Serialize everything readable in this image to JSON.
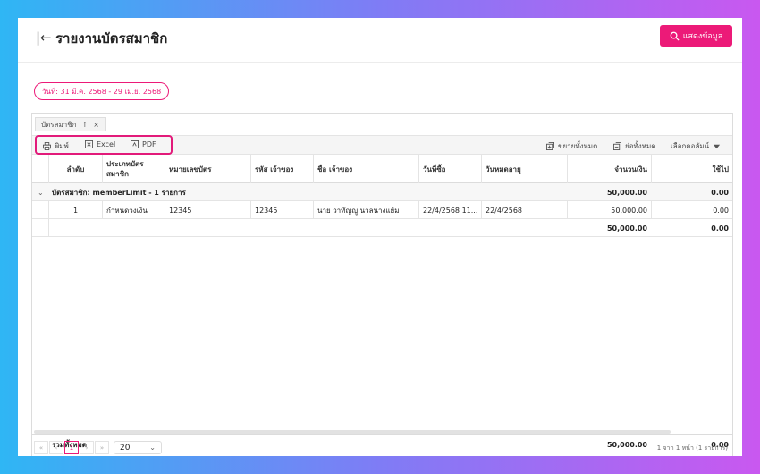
{
  "header": {
    "title": "รายงานบัตรสมาชิก",
    "show_button": "แสดงข้อมูล"
  },
  "filter": {
    "date_range": "วันที่: 31 มี.ค. 2568 - 29 เม.ย. 2568"
  },
  "grid": {
    "group_tab": {
      "label": "บัตรสมาชิก",
      "sort": "↑",
      "remove": "×"
    },
    "toolbar": {
      "print": "พิมพ์",
      "excel": "Excel",
      "pdf": "PDF",
      "expand_all": "ขยายทั้งหมด",
      "collapse_all": "ย่อทั้งหมด",
      "choose_columns": "เลือกคอลัมน์"
    },
    "columns": [
      "ลำดับ",
      "ประเภทบัตร\nสมาชิก",
      "หมายเลขบัตร",
      "รหัส เจ้าของ",
      "ชื่อ เจ้าของ",
      "วันที่ซื้อ",
      "วันหมดอายุ",
      "จำนวนเงิน",
      "ใช้ไป"
    ],
    "group": {
      "label": "บัตรสมาชิก: memberLimit - 1 รายการ",
      "amount": "50,000.00",
      "used": "0.00"
    },
    "rows": [
      {
        "no": "1",
        "type": "กำหนดวงเงิน",
        "card_no": "12345",
        "owner_code": "12345",
        "owner_name": "นาย วาทัญญู นวลนางแย้ม",
        "buy_date": "22/4/2568 11...",
        "expire_date": "22/4/2568",
        "amount": "50,000.00",
        "used": "0.00"
      }
    ],
    "subtotal": {
      "amount": "50,000.00",
      "used": "0.00"
    },
    "footer": {
      "label": "รวมทั้งหมด",
      "amount": "50,000.00",
      "used": "0.00"
    }
  },
  "pager": {
    "first": "«",
    "prev": "‹",
    "page": "1",
    "next": "›",
    "last": "»",
    "page_size": "20",
    "info": "1 จาก 1 หน้า (1 รายการ)"
  },
  "colors": {
    "accent": "#ec1a78"
  }
}
